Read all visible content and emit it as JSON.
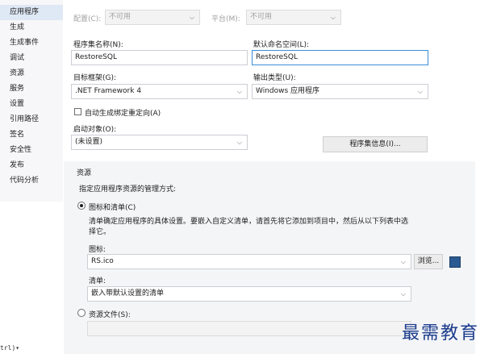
{
  "sidebar": {
    "items": [
      {
        "label": "应用程序"
      },
      {
        "label": "生成"
      },
      {
        "label": "生成事件"
      },
      {
        "label": "调试"
      },
      {
        "label": "资源"
      },
      {
        "label": "服务"
      },
      {
        "label": "设置"
      },
      {
        "label": "引用路径"
      },
      {
        "label": "签名"
      },
      {
        "label": "安全性"
      },
      {
        "label": "发布"
      },
      {
        "label": "代码分析"
      }
    ]
  },
  "config": {
    "config_label": "配置(C):",
    "config_value": "不可用",
    "platform_label": "平台(M):",
    "platform_value": "不可用"
  },
  "assembly": {
    "name_label": "程序集名称(N):",
    "name_value": "RestoreSQL",
    "namespace_label": "默认命名空间(L):",
    "namespace_value": "RestoreSQL"
  },
  "framework": {
    "label": "目标框架(G):",
    "value": ".NET Framework 4"
  },
  "output": {
    "label": "输出类型(U):",
    "value": "Windows 应用程序"
  },
  "autobind": {
    "label": "自动生成绑定重定向(A)",
    "checked": false
  },
  "startup": {
    "label": "启动对象(O):",
    "value": "(未设置)",
    "assembly_info_button": "程序集信息(I)..."
  },
  "resources": {
    "group_title": "资源",
    "description": "指定应用程序资源的管理方式:",
    "icon_manifest_option": "图标和清单(C)",
    "manifest_help_line1": "清单确定应用程序的具体设置。要嵌入自定义清单，请首先将它添加到项目中，然后从以下列表中选",
    "manifest_help_line2": "择它。",
    "icon_label": "图标:",
    "icon_value": "RS.ico",
    "browse_button": "浏览...",
    "manifest_label": "清单:",
    "manifest_value": "嵌入带默认设置的清单",
    "resource_file_option": "资源文件(S):",
    "resource_file_value": ""
  },
  "watermark": "最需教育",
  "bottom_fragment": "trl)▾"
}
